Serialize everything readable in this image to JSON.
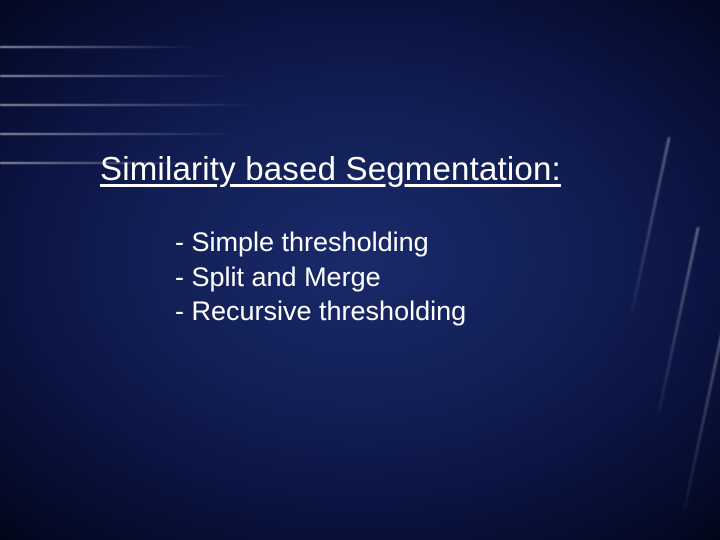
{
  "slide": {
    "title": "Similarity based Segmentation:",
    "bullets": [
      "- Simple thresholding",
      "- Split and Merge",
      "- Recursive thresholding"
    ]
  }
}
